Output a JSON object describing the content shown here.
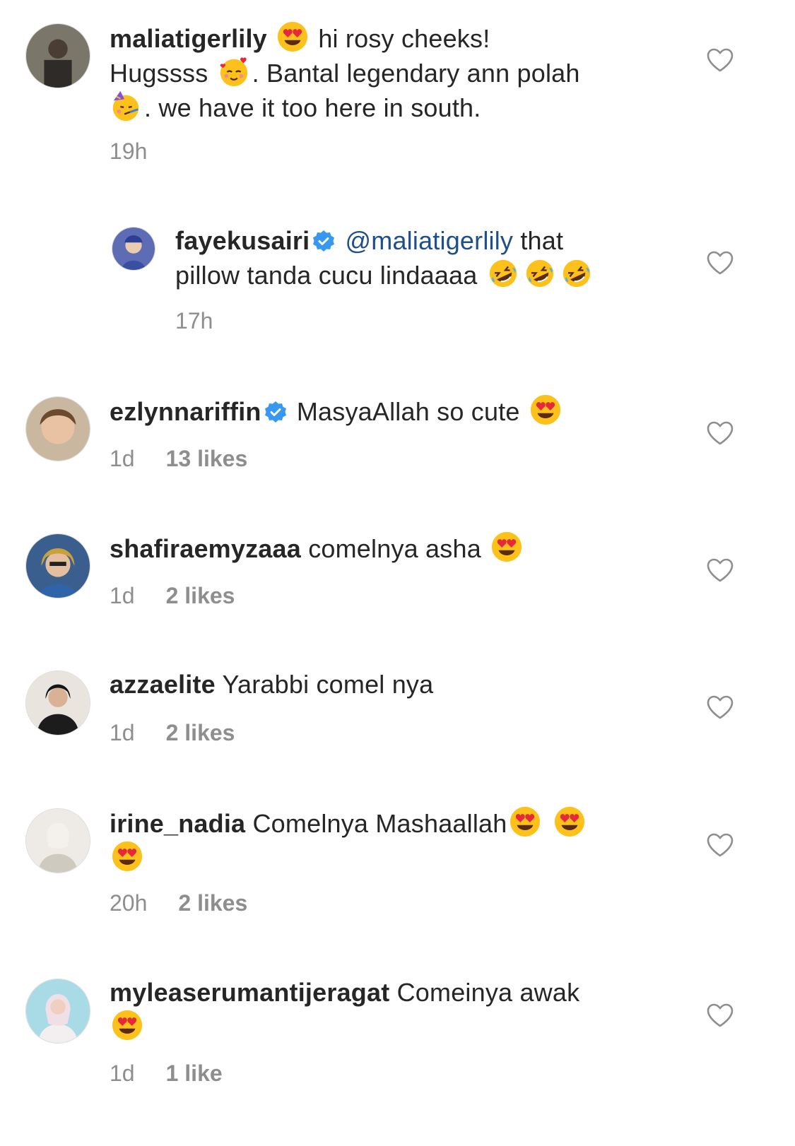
{
  "comments": [
    {
      "username": "maliatigerlily",
      "parts": [
        "hi rosy cheeks!",
        "Hugssss",
        ". Bantal legendary ann polah",
        ". we have it too here in south."
      ],
      "time": "19h",
      "avatar_color": "#6b6b5e",
      "heart_icon": "heart-outline-icon"
    },
    {
      "username": "fayekusairi",
      "verified": true,
      "mention": "@maliatigerlily",
      "parts": [
        "that",
        "pillow tanda cucu lindaaaa"
      ],
      "time": "17h",
      "avatar_color": "#4a5da8",
      "heart_icon": "heart-outline-icon"
    },
    {
      "username": "ezlynnariffin",
      "verified": true,
      "parts": [
        "MasyaAllah so cute"
      ],
      "time": "1d",
      "likes": "13 likes",
      "avatar_color": "#a98a70"
    },
    {
      "username": "shafiraemyzaaa",
      "parts": [
        "comelnya asha"
      ],
      "time": "1d",
      "likes": "2 likes",
      "avatar_color": "#3d6aa3"
    },
    {
      "username": "azzaelite",
      "parts": [
        "Yarabbi comel nya"
      ],
      "time": "1d",
      "likes": "2 likes",
      "avatar_color": "#2b2b2b"
    },
    {
      "username": "irine_nadia",
      "parts": [
        "Comelnya Mashaallah"
      ],
      "time": "20h",
      "likes": "2 likes",
      "avatar_color": "#d9d4cc"
    },
    {
      "username": "myleaserumantijeragat",
      "parts": [
        "Comeinya awak"
      ],
      "time": "1d",
      "likes": "1 like",
      "avatar_color": "#9fd3e0"
    }
  ],
  "colors": {
    "text": "#262626",
    "meta": "#8e8e8e",
    "mention": "#1f4f8b",
    "verified": "#3897f0"
  }
}
